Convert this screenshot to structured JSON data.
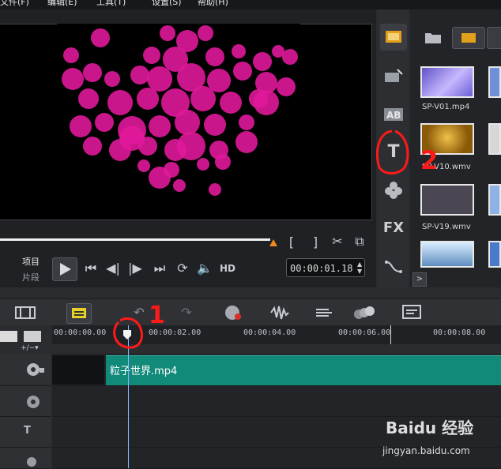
{
  "menu": [
    "文件(F)",
    "编辑(E)",
    "工具(T)",
    "设置(S)",
    "帮助(H)"
  ],
  "player": {
    "mode_project": "项目",
    "mode_clip": "片段",
    "hd_label": "HD",
    "timecode": "00:00:01.18"
  },
  "library": {
    "thumbnails": [
      {
        "label": "SP-V01.mp4",
        "color": "#8d7ee0"
      },
      {
        "label": "SP-V10.wmv",
        "color": "#b37a12"
      },
      {
        "label": "SP-V19.wmv",
        "color": "#4a4652"
      }
    ],
    "tabs": [
      "media-icon",
      "instant-project-icon",
      "transition-icon",
      "title-icon",
      "graphic-icon",
      "filter-icon",
      "path-icon"
    ]
  },
  "timeline": {
    "ruler": [
      "00:00:00.00",
      "00:00:02.00",
      "00:00:04.00",
      "00:00:06.00",
      "00:00:08.00"
    ],
    "clip_name": "粒子世界.mp4"
  },
  "annotations": [
    "1",
    "2"
  ],
  "watermark": {
    "brand": "Baidu 经验",
    "url": "jingyan.baidu.com"
  },
  "colors": {
    "accent": "#f08a1c",
    "clip": "#128a7a",
    "particle": "#e0189a",
    "annotation": "#ff1a1a"
  }
}
